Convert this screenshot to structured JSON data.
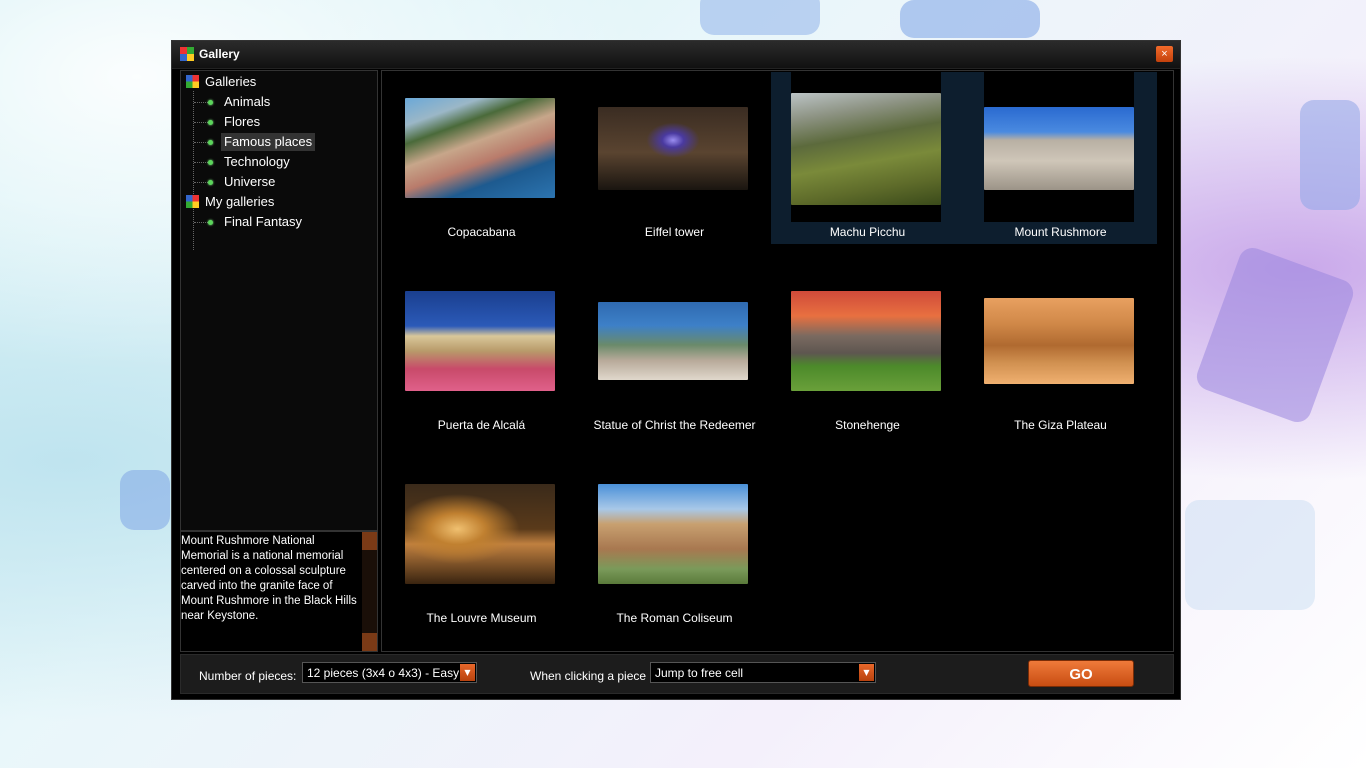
{
  "window": {
    "title": "Gallery",
    "close_label": "×"
  },
  "tree": {
    "root1": {
      "label": "Galleries",
      "icon": "galleries-icon"
    },
    "galleries": [
      {
        "label": "Animals"
      },
      {
        "label": "Flores"
      },
      {
        "label": "Famous places",
        "selected": true
      },
      {
        "label": "Technology"
      },
      {
        "label": "Universe"
      }
    ],
    "root2": {
      "label": "My galleries",
      "icon": "my-galleries-icon"
    },
    "my_galleries": [
      {
        "label": "Final Fantasy"
      }
    ]
  },
  "description": "Mount Rushmore National Memorial is a national memorial centered on a colossal sculpture carved into the granite face of Mount Rushmore in the Black Hills near Keystone.",
  "items": [
    {
      "label": "Copacabana",
      "selected": false
    },
    {
      "label": "Eiffel tower",
      "selected": false
    },
    {
      "label": "Machu Picchu",
      "selected": true
    },
    {
      "label": "Mount Rushmore",
      "selected": true
    },
    {
      "label": "Puerta de Alcalá",
      "selected": false
    },
    {
      "label": "Statue of Christ the Redeemer",
      "selected": false
    },
    {
      "label": "Stonehenge",
      "selected": false
    },
    {
      "label": "The Giza Plateau",
      "selected": false
    },
    {
      "label": "The Louvre Museum",
      "selected": false
    },
    {
      "label": "The Roman Coliseum",
      "selected": false
    }
  ],
  "bottom": {
    "pieces_label": "Number of pieces:",
    "pieces_value": "12 pieces (3x4 o 4x3) - Easy",
    "click_label": "When clicking a piece",
    "click_value": "Jump to free cell",
    "go_label": "GO"
  },
  "colors": {
    "accent": "#e0601f",
    "selection": "#0d1e2e",
    "tree_bullet": "#5cd65c"
  }
}
